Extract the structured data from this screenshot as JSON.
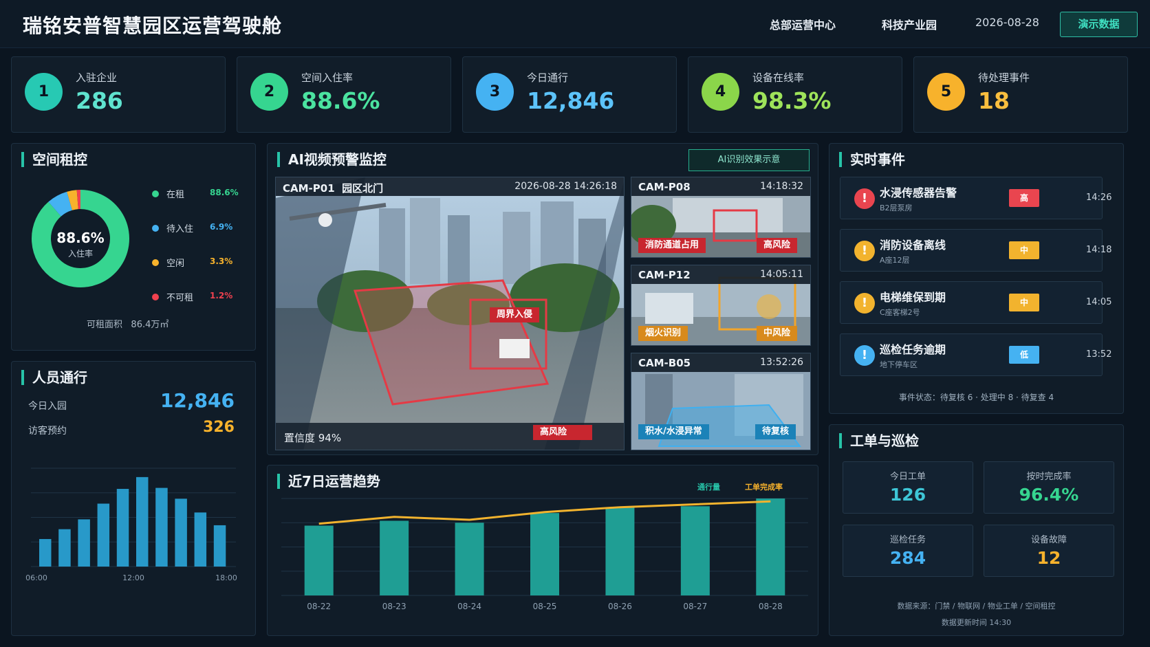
{
  "header": {
    "title": "瑞铭安普智慧园区运营驾驶舱",
    "nav": [
      "总部运营中心",
      "科技产业园"
    ],
    "date": "2026-08-28",
    "demo_button": "演示数据"
  },
  "kpis": [
    {
      "index": "1",
      "label": "入驻企业",
      "value": "286",
      "color": "#27c9b3"
    },
    {
      "index": "2",
      "label": "空间入住率",
      "value": "88.6%",
      "color": "#36d590"
    },
    {
      "index": "3",
      "label": "今日通行",
      "value": "12,846",
      "color": "#45b2f2"
    },
    {
      "index": "4",
      "label": "设备在线率",
      "value": "98.3%",
      "color": "#8bd64a"
    },
    {
      "index": "5",
      "label": "待处理事件",
      "value": "18",
      "color": "#f7b22c"
    }
  ],
  "rent": {
    "title": "空间租控",
    "center_value": "88.6%",
    "center_label": "入住率",
    "legend": [
      {
        "name": "在租",
        "pct": "88.6%",
        "value": 88.6,
        "color": "#36d590"
      },
      {
        "name": "待入住",
        "pct": "6.9%",
        "value": 6.9,
        "color": "#45b2f2"
      },
      {
        "name": "空闲",
        "pct": "3.3%",
        "value": 3.3,
        "color": "#f7b22c"
      },
      {
        "name": "不可租",
        "pct": "1.2%",
        "value": 1.2,
        "color": "#f0414f"
      }
    ],
    "area_label": "可租面积",
    "area_value": "86.4万㎡"
  },
  "traffic": {
    "title": "人员通行",
    "today_label": "今日入园",
    "today_value": "12,846",
    "visitor_label": "访客预约",
    "visitor_value": "326",
    "chart_data": {
      "type": "bar",
      "x_ticks": [
        "06:00",
        "12:00",
        "18:00"
      ],
      "values": [
        28,
        38,
        48,
        64,
        79,
        91,
        80,
        69,
        55,
        42
      ]
    }
  },
  "video": {
    "title": "AI视频预警监控",
    "badge": "AI识别效果示意",
    "main": {
      "id": "CAM-P01",
      "location": "园区北门",
      "time": "2026-08-28  14:26:18",
      "alert": "周界入侵",
      "confidence": "置信度 94%",
      "risk": "高风险"
    },
    "cams": [
      {
        "id": "CAM-P08",
        "time": "14:18:32",
        "tag": "消防通道占用",
        "risk": "高风险"
      },
      {
        "id": "CAM-P12",
        "time": "14:05:11",
        "tag": "烟火识别",
        "risk": "中风险"
      },
      {
        "id": "CAM-B05",
        "time": "13:52:26",
        "tag": "积水/水浸异常",
        "risk": "待复核"
      }
    ]
  },
  "trend": {
    "title": "近7日运营趋势",
    "legend_bar": "通行量",
    "legend_line": "工单完成率",
    "chart_data": {
      "type": "bar",
      "categories": [
        "08-22",
        "08-23",
        "08-24",
        "08-25",
        "08-26",
        "08-27",
        "08-28"
      ],
      "series": [
        {
          "name": "通行量",
          "values": [
            72,
            77,
            75,
            85,
            91,
            92,
            100
          ]
        },
        {
          "name": "工单完成率",
          "values": [
            74,
            81,
            78,
            86,
            91,
            94,
            97
          ]
        }
      ]
    }
  },
  "events": {
    "title": "实时事件",
    "items": [
      {
        "title": "水浸传感器告警",
        "loc": "B2层泵房",
        "level": "高",
        "time": "14:26",
        "color": "#e9454f"
      },
      {
        "title": "消防设备离线",
        "loc": "A座12层",
        "level": "中",
        "time": "14:18",
        "color": "#f2b32e"
      },
      {
        "title": "电梯维保到期",
        "loc": "C座客梯2号",
        "level": "中",
        "time": "14:05",
        "color": "#f2b32e"
      },
      {
        "title": "巡检任务逾期",
        "loc": "地下停车区",
        "level": "低",
        "time": "13:52",
        "color": "#45b2f2"
      }
    ],
    "summary": "事件状态：待复核 6 · 处理中 8 · 待复查 4"
  },
  "workorders": {
    "title": "工单与巡检",
    "cards": [
      {
        "label": "今日工单",
        "value": "126",
        "color": "#3ec6d6"
      },
      {
        "label": "按时完成率",
        "value": "96.4%",
        "color": "#36d590"
      },
      {
        "label": "巡检任务",
        "value": "284",
        "color": "#45b2f2"
      },
      {
        "label": "设备故障",
        "value": "12",
        "color": "#f7b22c"
      }
    ],
    "source": "数据来源：门禁 / 物联网 / 物业工单 / 空间租控",
    "updated": "数据更新时间 14:30"
  }
}
